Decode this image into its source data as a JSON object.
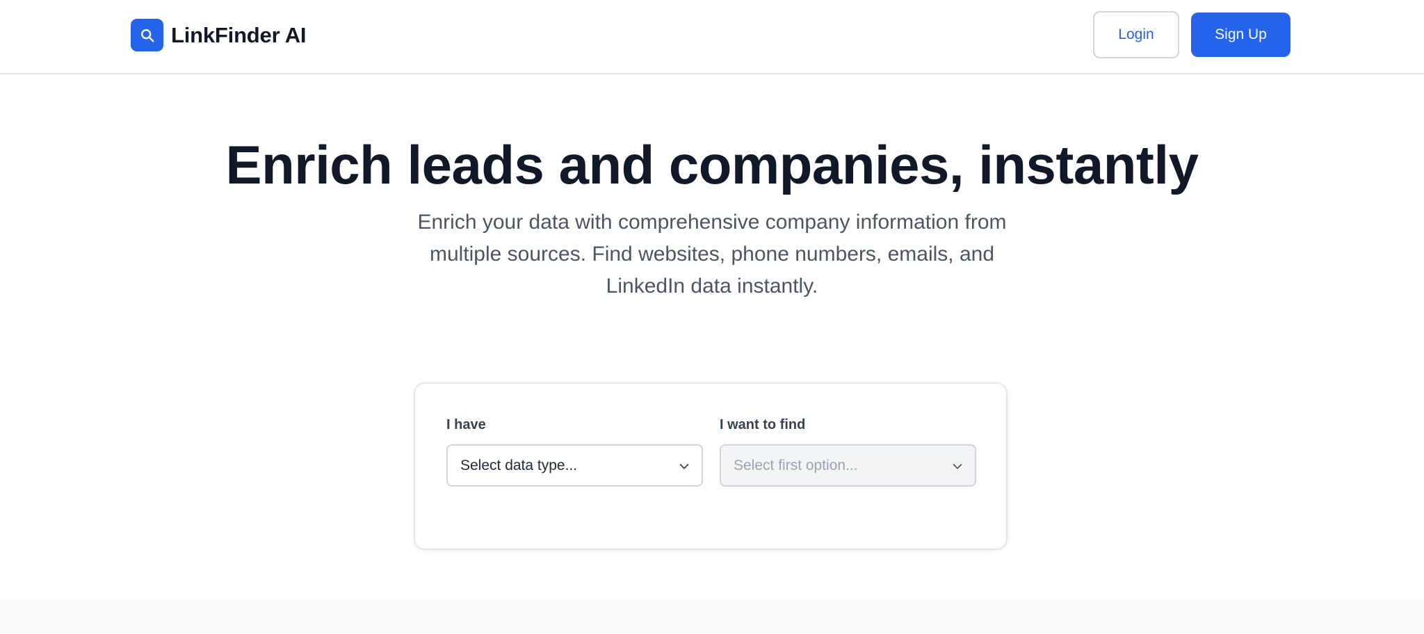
{
  "header": {
    "brand_name": "LinkFinder AI",
    "brand_icon": "search-icon",
    "login_label": "Login",
    "signup_label": "Sign Up"
  },
  "hero": {
    "title": "Enrich leads and companies, instantly",
    "subtitle": "Enrich your data with comprehensive company information from multiple sources. Find websites, phone numbers, emails, and LinkedIn data instantly."
  },
  "form": {
    "have_label": "I have",
    "have_placeholder": "Select data type...",
    "find_label": "I want to find",
    "find_placeholder": "Select first option..."
  },
  "colors": {
    "accent": "#2563eb",
    "title_text": "#111827",
    "body_text": "#4b5563",
    "border": "#e5e7eb",
    "disabled_bg": "#f3f4f6"
  }
}
